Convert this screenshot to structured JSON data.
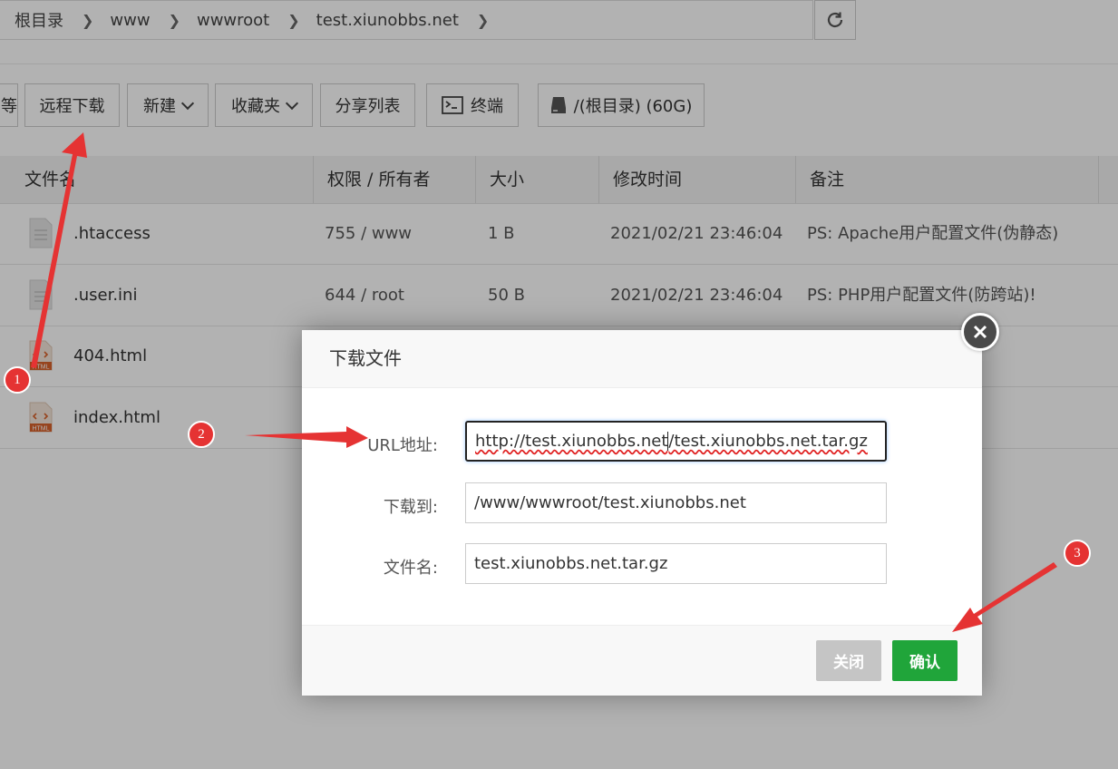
{
  "breadcrumb": [
    "根目录",
    "www",
    "wwwroot",
    "test.xiunobbs.net"
  ],
  "toolbar": {
    "partial_label": "等",
    "remote_download": "远程下载",
    "new": "新建",
    "favorites": "收藏夹",
    "share_list": "分享列表",
    "terminal": "终端",
    "disk": "/(根目录) (60G)"
  },
  "table": {
    "headers": [
      "文件名",
      "权限 / 所有者",
      "大小",
      "修改时间",
      "备注"
    ],
    "rows": [
      {
        "name": ".htaccess",
        "perm": "755 / www",
        "size": "1 B",
        "mtime": "2021/02/21 23:46:04",
        "note": "PS: Apache用户配置文件(伪静态)"
      },
      {
        "name": ".user.ini",
        "perm": "644 / root",
        "size": "50 B",
        "mtime": "2021/02/21 23:46:04",
        "note": "PS: PHP用户配置文件(防跨站)!"
      },
      {
        "name": "404.html",
        "perm": "",
        "size": "",
        "mtime": "",
        "note": ""
      },
      {
        "name": "index.html",
        "perm": "",
        "size": "",
        "mtime": "",
        "note": ""
      }
    ]
  },
  "dialog": {
    "title": "下载文件",
    "url_label": "URL地址:",
    "url_value": "http://test.xiunobbs.net/test.xiunobbs.net.tar.gz",
    "url_part1": "http://test.xiunobbs.net",
    "url_part2": "/test.xiunobbs.net.tar.gz",
    "dest_label": "下载到:",
    "dest_value": "/www/wwwroot/test.xiunobbs.net",
    "filename_label": "文件名:",
    "filename_value": "test.xiunobbs.net.tar.gz",
    "close_btn": "关闭",
    "confirm_btn": "确认"
  },
  "annotations": [
    "1",
    "2",
    "3"
  ],
  "icons": {
    "refresh": "refresh-icon",
    "terminal": "terminal-icon",
    "disk": "disk-icon",
    "text_file": "text-file-icon",
    "html_file": "html-file-icon",
    "close": "close-icon"
  },
  "html_icon_text": "HTML",
  "colors": {
    "accent_green": "#20a53a",
    "annotation_red": "#e53333",
    "close_btn_gray": "#c5c5c5"
  }
}
